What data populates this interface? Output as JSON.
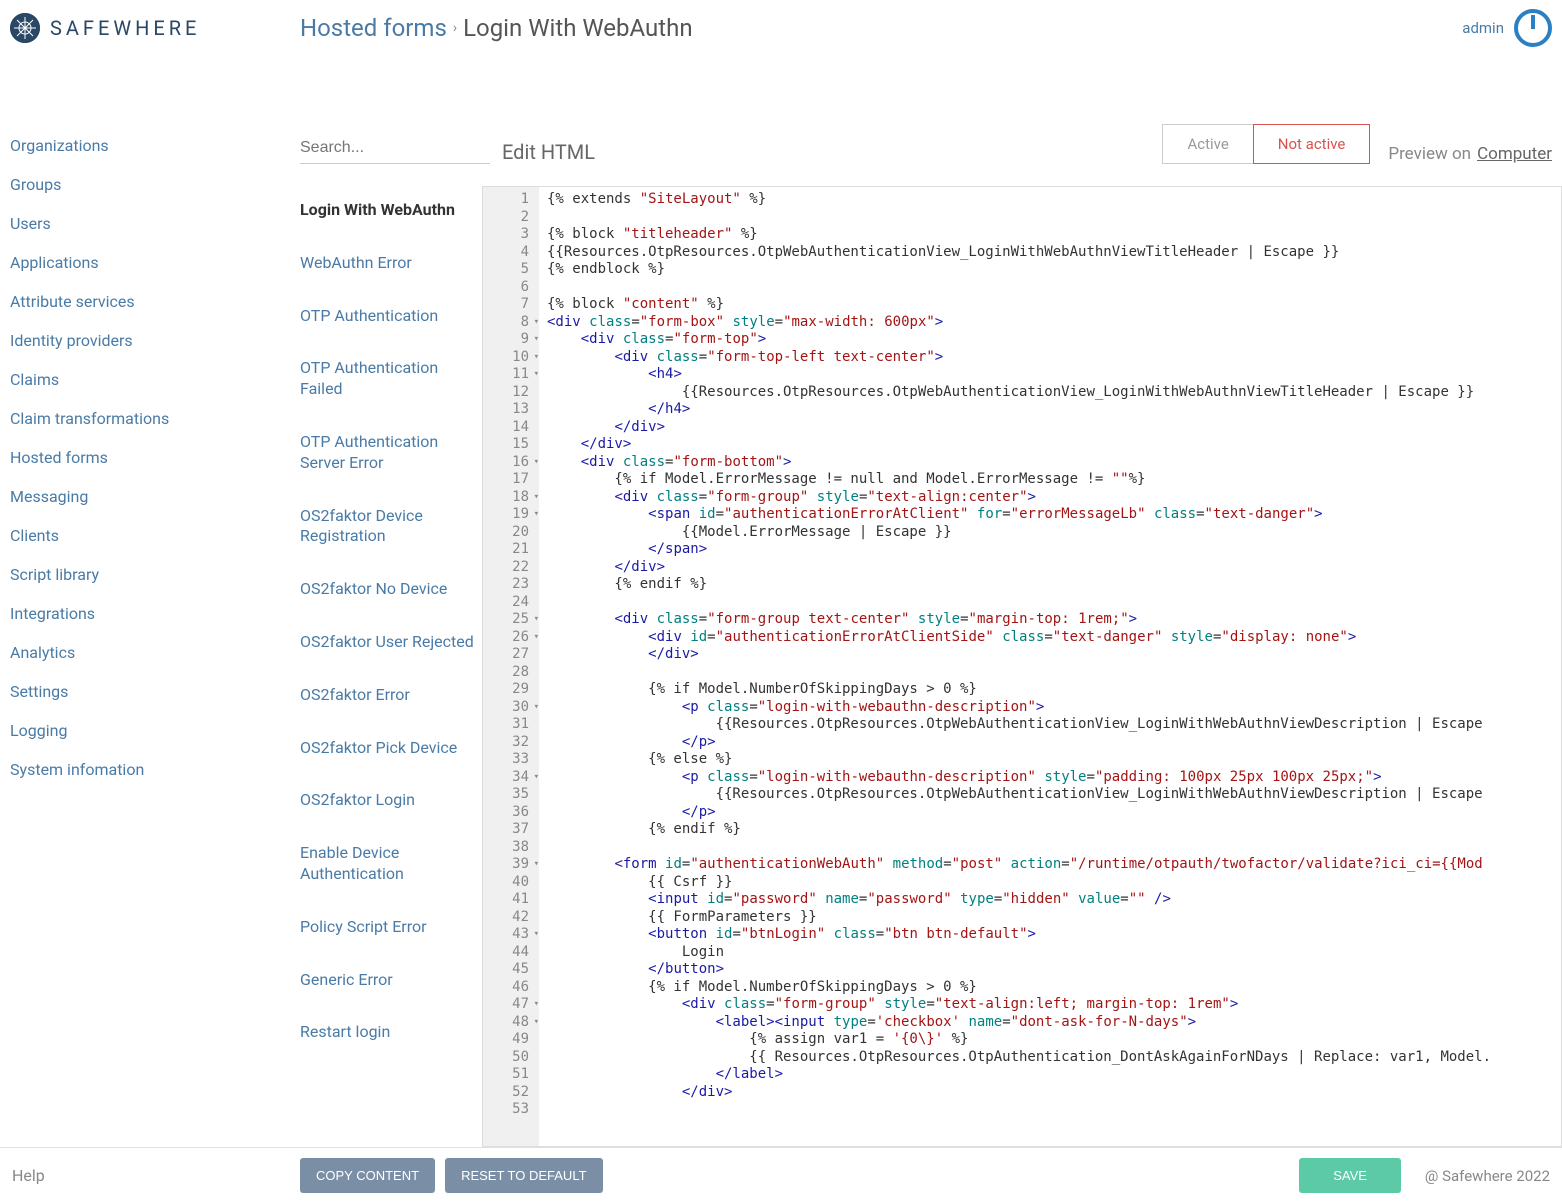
{
  "brand": {
    "name": "SAFEWHERE"
  },
  "breadcrumb": {
    "root": "Hosted forms",
    "current": "Login With WebAuthn"
  },
  "header": {
    "user": "admin"
  },
  "sidebar": {
    "items": [
      "Organizations",
      "Groups",
      "Users",
      "Applications",
      "Attribute services",
      "Identity providers",
      "Claims",
      "Claim transformations",
      "Hosted forms",
      "Messaging",
      "Clients",
      "Script library",
      "Integrations",
      "Analytics",
      "Settings",
      "Logging",
      "System infomation"
    ]
  },
  "toolbar": {
    "search_placeholder": "Search...",
    "edit_label": "Edit HTML",
    "active_label": "Active",
    "not_active_label": "Not active",
    "preview_label": "Preview on",
    "preview_target": "Computer"
  },
  "forms": [
    "Login With WebAuthn",
    "WebAuthn Error",
    "OTP Authentication",
    "OTP Authentication Failed",
    "OTP Authentication Server Error",
    "OS2faktor Device Registration",
    "OS2faktor No Device",
    "OS2faktor User Rejected",
    "OS2faktor Error",
    "OS2faktor Pick Device",
    "OS2faktor Login",
    "Enable Device Authentication",
    "Policy Script Error",
    "Generic Error",
    "Restart login"
  ],
  "editor": {
    "line_count": 53,
    "fold_lines": [
      8,
      9,
      10,
      11,
      16,
      18,
      19,
      25,
      26,
      30,
      34,
      39,
      43,
      47,
      48
    ]
  },
  "footer": {
    "help": "Help",
    "copy_btn": "COPY CONTENT",
    "reset_btn": "RESET TO DEFAULT",
    "save_btn": "SAVE",
    "copyright": "@ Safewhere 2022"
  }
}
